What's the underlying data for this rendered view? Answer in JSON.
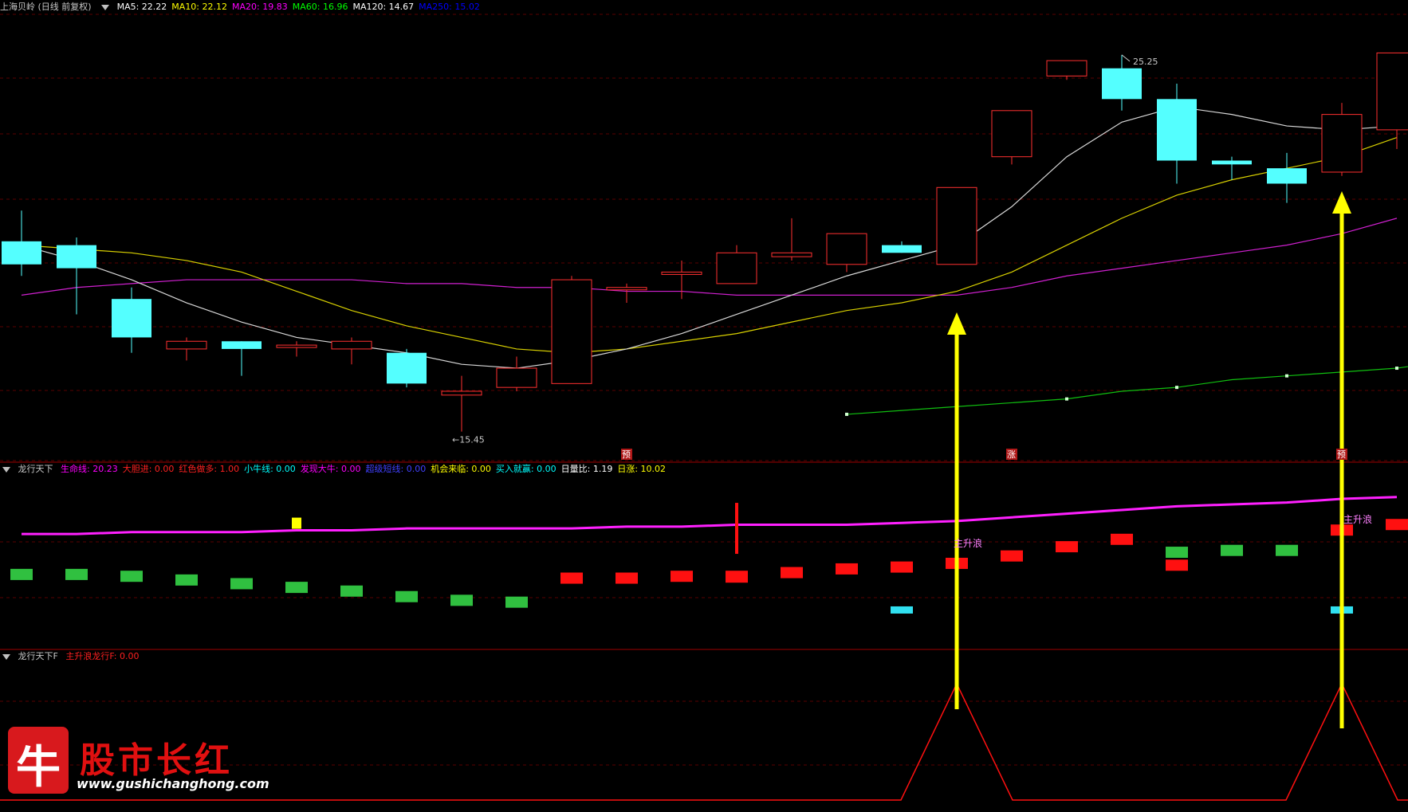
{
  "header_main": {
    "title": "上海贝岭 (日线 前复权)",
    "items": [
      {
        "label": "MA5:",
        "value": "22.22",
        "color": "#ffffff"
      },
      {
        "label": "MA10:",
        "value": "22.12",
        "color": "#ffff00"
      },
      {
        "label": "MA20:",
        "value": "19.83",
        "color": "#ff00ff"
      },
      {
        "label": "MA60:",
        "value": "16.96",
        "color": "#00ff00"
      },
      {
        "label": "MA120:",
        "value": "14.67",
        "color": "#ffffff"
      },
      {
        "label": "MA250:",
        "value": "15.02",
        "color": "#0000ff"
      }
    ]
  },
  "header_ind1": {
    "title": "龙行天下",
    "items": [
      {
        "label": "生命线:",
        "value": "20.23",
        "color": "#ff00ff"
      },
      {
        "label": "大胆进:",
        "value": "0.00",
        "color": "#ff2020"
      },
      {
        "label": "红色做多:",
        "value": "1.00",
        "color": "#ff2020"
      },
      {
        "label": "小牛线:",
        "value": "0.00",
        "color": "#00ffff"
      },
      {
        "label": "发现大牛:",
        "value": "0.00",
        "color": "#ff00ff"
      },
      {
        "label": "超级短线:",
        "value": "0.00",
        "color": "#4040ff"
      },
      {
        "label": "机会来临:",
        "value": "0.00",
        "color": "#ffff00"
      },
      {
        "label": "买入就赢:",
        "value": "0.00",
        "color": "#00ffff"
      },
      {
        "label": "日量比:",
        "value": "1.19",
        "color": "#ffffff"
      },
      {
        "label": "日涨:",
        "value": "10.02",
        "color": "#ffff00"
      }
    ]
  },
  "header_ind2": {
    "title": "龙行天下F",
    "items": [
      {
        "label": "主升浪龙行F:",
        "value": "0.00",
        "color": "#ff2020"
      }
    ]
  },
  "annotations": {
    "high_label": "25.25",
    "low_label": "15.45",
    "wave_label_1": "主升浪",
    "wave_label_2": "主升浪",
    "marker_yu": "预",
    "marker_zhang": "涨",
    "marker_3": "预"
  },
  "logo": {
    "char": "牛",
    "title": "股市长红",
    "url": "www.gushichanghong.com"
  },
  "colors": {
    "up": "#ff3030",
    "down": "#54ffff",
    "grid": "#8b0000",
    "arrow": "#ffff00"
  },
  "chart_data": {
    "type": "candlestick",
    "price_range": [
      14.8,
      26.2
    ],
    "candles": [
      {
        "o": 20.4,
        "h": 21.2,
        "l": 19.5,
        "c": 19.8
      },
      {
        "o": 20.3,
        "h": 20.5,
        "l": 18.5,
        "c": 19.7
      },
      {
        "o": 18.9,
        "h": 19.2,
        "l": 17.5,
        "c": 17.9
      },
      {
        "o": 17.6,
        "h": 17.9,
        "l": 17.3,
        "c": 17.8
      },
      {
        "o": 17.8,
        "h": 17.8,
        "l": 16.9,
        "c": 17.6
      },
      {
        "o": 17.7,
        "h": 17.8,
        "l": 17.4,
        "c": 17.7
      },
      {
        "o": 17.6,
        "h": 17.9,
        "l": 17.2,
        "c": 17.8
      },
      {
        "o": 17.5,
        "h": 17.6,
        "l": 16.6,
        "c": 16.7
      },
      {
        "o": 16.4,
        "h": 16.9,
        "l": 15.45,
        "c": 16.5
      },
      {
        "o": 16.6,
        "h": 17.4,
        "l": 16.5,
        "c": 17.1
      },
      {
        "o": 16.7,
        "h": 19.5,
        "l": 16.7,
        "c": 19.4
      },
      {
        "o": 19.2,
        "h": 19.3,
        "l": 18.8,
        "c": 19.2
      },
      {
        "o": 19.6,
        "h": 19.9,
        "l": 18.9,
        "c": 19.6
      },
      {
        "o": 19.3,
        "h": 20.3,
        "l": 19.3,
        "c": 20.1
      },
      {
        "o": 20.0,
        "h": 21.0,
        "l": 19.9,
        "c": 20.1
      },
      {
        "o": 19.8,
        "h": 20.6,
        "l": 19.6,
        "c": 20.6
      },
      {
        "o": 20.3,
        "h": 20.4,
        "l": 20.1,
        "c": 20.1
      },
      {
        "o": 19.8,
        "h": 21.8,
        "l": 19.8,
        "c": 21.8
      },
      {
        "o": 22.6,
        "h": 23.8,
        "l": 22.4,
        "c": 23.8
      },
      {
        "o": 24.7,
        "h": 25.0,
        "l": 24.6,
        "c": 25.1
      },
      {
        "o": 24.9,
        "h": 25.25,
        "l": 23.8,
        "c": 24.1
      },
      {
        "o": 24.1,
        "h": 24.5,
        "l": 21.9,
        "c": 22.5
      },
      {
        "o": 22.5,
        "h": 22.6,
        "l": 22.0,
        "c": 22.4
      },
      {
        "o": 22.3,
        "h": 22.7,
        "l": 21.4,
        "c": 21.9
      },
      {
        "o": 22.2,
        "h": 24.0,
        "l": 22.1,
        "c": 23.7
      },
      {
        "o": 23.3,
        "h": 25.3,
        "l": 22.8,
        "c": 25.3
      }
    ],
    "ma5": [
      20.3,
      19.9,
      19.4,
      18.8,
      18.3,
      17.9,
      17.7,
      17.5,
      17.2,
      17.1,
      17.3,
      17.6,
      18.0,
      18.5,
      19.0,
      19.5,
      19.9,
      20.3,
      21.3,
      22.6,
      23.5,
      23.9,
      23.7,
      23.4,
      23.3,
      23.4
    ],
    "ma10": [
      20.3,
      20.2,
      20.1,
      19.9,
      19.6,
      19.1,
      18.6,
      18.2,
      17.9,
      17.6,
      17.5,
      17.6,
      17.8,
      18.0,
      18.3,
      18.6,
      18.8,
      19.1,
      19.6,
      20.3,
      21.0,
      21.6,
      22.0,
      22.3,
      22.6,
      23.1
    ],
    "ma20": [
      19.0,
      19.2,
      19.3,
      19.4,
      19.4,
      19.4,
      19.4,
      19.3,
      19.3,
      19.2,
      19.2,
      19.1,
      19.1,
      19.0,
      19.0,
      19.0,
      19.0,
      19.0,
      19.2,
      19.5,
      19.7,
      19.9,
      20.1,
      20.3,
      20.6,
      21.0
    ],
    "ma60_start_index": 15,
    "ma60": [
      15.9,
      16.0,
      16.1,
      16.2,
      16.3,
      16.5,
      16.6,
      16.8,
      16.9,
      17.0,
      17.1,
      17.3
    ],
    "ind1": {
      "life_line_values": [
        0.41,
        0.41,
        0.4,
        0.4,
        0.4,
        0.39,
        0.39,
        0.38,
        0.38,
        0.38,
        0.38,
        0.37,
        0.37,
        0.36,
        0.36,
        0.36,
        0.35,
        0.34,
        0.32,
        0.3,
        0.28,
        0.26,
        0.25,
        0.24,
        0.22,
        0.21
      ],
      "bars": [
        {
          "i": 0,
          "color": "green",
          "level": 0.41
        },
        {
          "i": 1,
          "color": "green",
          "level": 0.41
        },
        {
          "i": 2,
          "color": "green",
          "level": 0.4
        },
        {
          "i": 3,
          "color": "green",
          "level": 0.38
        },
        {
          "i": 4,
          "color": "green",
          "level": 0.36
        },
        {
          "i": 5,
          "color": "green",
          "level": 0.34
        },
        {
          "i": 6,
          "color": "green",
          "level": 0.32
        },
        {
          "i": 7,
          "color": "green",
          "level": 0.29
        },
        {
          "i": 8,
          "color": "green",
          "level": 0.27
        },
        {
          "i": 9,
          "color": "green",
          "level": 0.26
        },
        {
          "i": 10,
          "color": "red",
          "level": 0.39
        },
        {
          "i": 11,
          "color": "red",
          "level": 0.39
        },
        {
          "i": 12,
          "color": "red",
          "level": 0.4
        },
        {
          "i": 13,
          "color": "red",
          "level": 0.4
        },
        {
          "i": 14,
          "color": "red",
          "level": 0.42
        },
        {
          "i": 15,
          "color": "red",
          "level": 0.44
        },
        {
          "i": 16,
          "color": "red",
          "level": 0.45
        },
        {
          "i": 17,
          "color": "red",
          "level": 0.47
        },
        {
          "i": 18,
          "color": "red",
          "level": 0.51
        },
        {
          "i": 19,
          "color": "red",
          "level": 0.56
        },
        {
          "i": 20,
          "color": "red",
          "level": 0.6
        },
        {
          "i": 21,
          "color": "green",
          "level": 0.53
        },
        {
          "i": 21,
          "color": "red",
          "level": 0.46
        },
        {
          "i": 22,
          "color": "green",
          "level": 0.54
        },
        {
          "i": 23,
          "color": "green",
          "level": 0.54
        },
        {
          "i": 24,
          "color": "red",
          "level": 0.65
        },
        {
          "i": 25,
          "color": "red",
          "level": 0.68
        }
      ],
      "cyan_marks": [
        16,
        24
      ],
      "yellow_mark": 5,
      "cross_mark": 13
    },
    "ind2_peaks": [
      17,
      24
    ]
  }
}
